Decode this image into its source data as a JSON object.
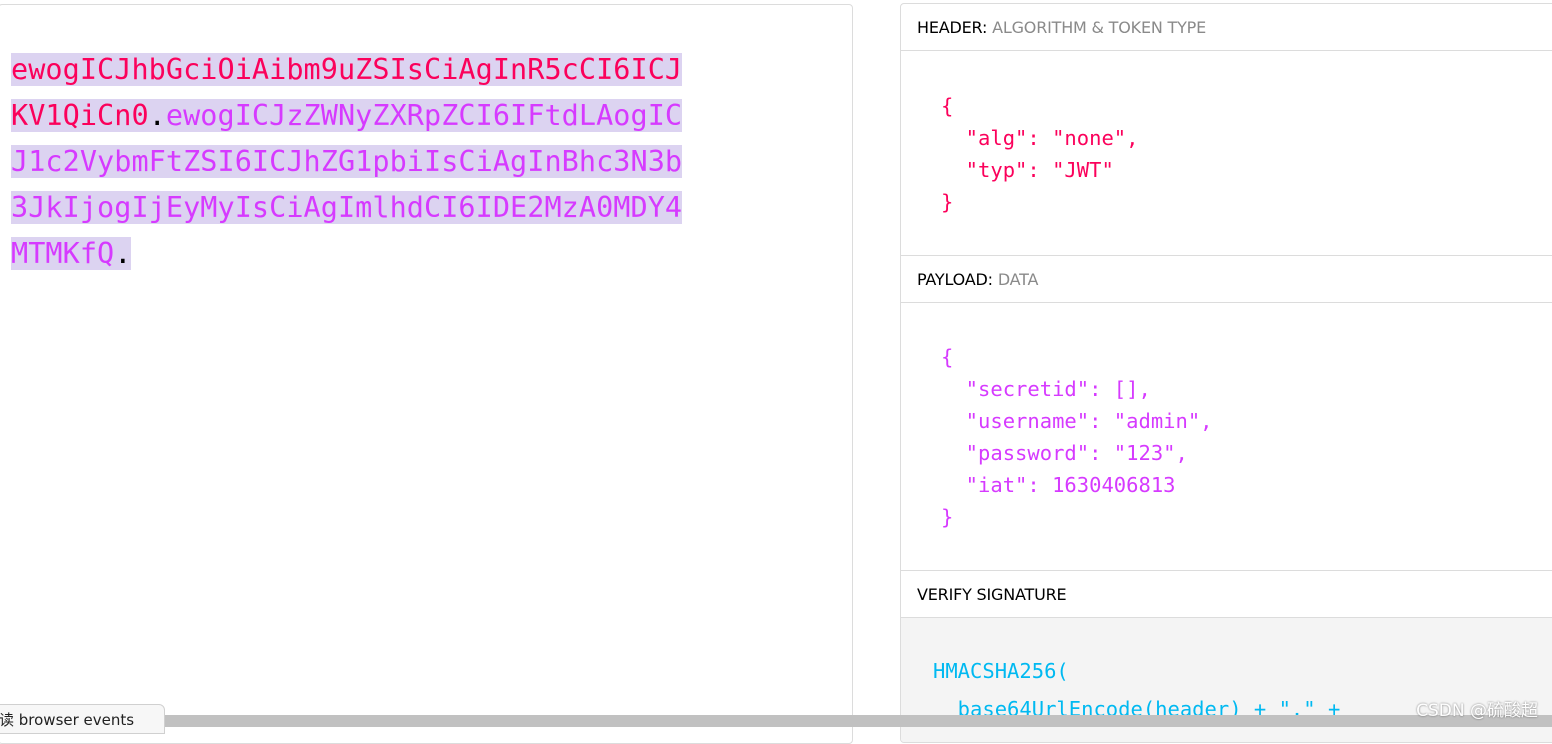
{
  "encoded": {
    "segments": [
      {
        "line": 1,
        "header": "ewogICJhbGciOiAibm9uZSIsCiAgInR5cCI6ICJ"
      },
      {
        "line": 2,
        "header": "KV1QiCn0",
        "separator": ".",
        "payload": "ewogICJzZWNyZXRpZCI6IFtdLAogIC"
      },
      {
        "line": 3,
        "payload": "J1c2VybmFtZSI6ICJhZG1pbiIsCiAgInBhc3N3b"
      },
      {
        "line": 4,
        "payload": "3JkIjogIjEyMyIsCiAgImlhdCI6IDE2MzA0MDY4"
      },
      {
        "line": 5,
        "payload": "MTMKfQ",
        "separator": "."
      }
    ],
    "colors": {
      "header": "#fb015b",
      "payload": "#d63aff",
      "highlight": "#dcd3f1"
    }
  },
  "decoded": {
    "header_section": {
      "title": "HEADER:",
      "subtitle": "ALGORITHM & TOKEN TYPE",
      "json_lines": [
        "{",
        "  \"alg\": \"none\",",
        "  \"typ\": \"JWT\"",
        "}"
      ]
    },
    "payload_section": {
      "title": "PAYLOAD:",
      "subtitle": "DATA",
      "json_lines": [
        "{",
        "  \"secretid\": [],",
        "  \"username\": \"admin\",",
        "  \"password\": \"123\",",
        "  \"iat\": 1630406813",
        "}"
      ]
    },
    "verify_section": {
      "title": "VERIFY SIGNATURE",
      "code_lines": [
        "HMACSHA256(",
        "  base64UrlEncode(header) + \".\" +"
      ]
    }
  },
  "status_bar": {
    "text": "读 browser events"
  },
  "watermark": {
    "text": "CSDN @硫酸超"
  }
}
